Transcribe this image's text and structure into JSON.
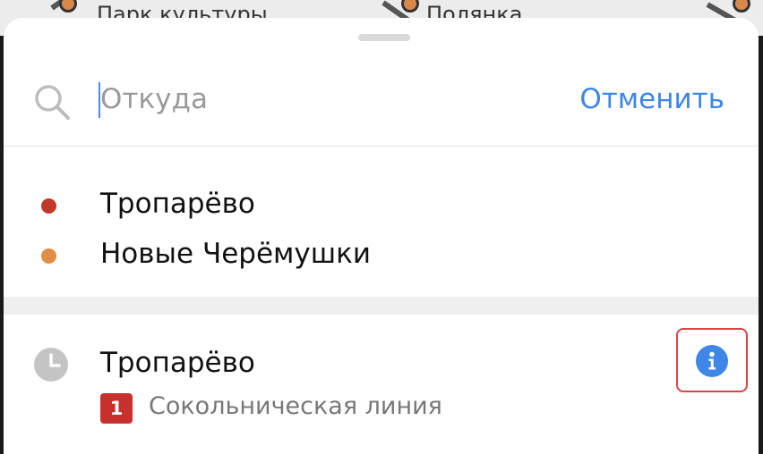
{
  "map": {
    "station_left": "Парк культуры",
    "station_right": "Полянка"
  },
  "search": {
    "placeholder": "Откуда",
    "value": "",
    "cancel_label": "Отменить",
    "icon": "search-icon"
  },
  "suggestions": [
    {
      "name": "Тропарёво",
      "line_color": "#c0392b"
    },
    {
      "name": "Новые Черёмушки",
      "line_color": "#e08d45"
    }
  ],
  "history": {
    "items": [
      {
        "name": "Тропарёво",
        "line_number": "1",
        "line_name": "Сокольническая линия",
        "line_color": "#c8302e",
        "icon": "clock-icon",
        "action_icon": "info-icon"
      }
    ]
  },
  "colors": {
    "accent": "#3e86e8",
    "highlight": "#e0414a"
  }
}
